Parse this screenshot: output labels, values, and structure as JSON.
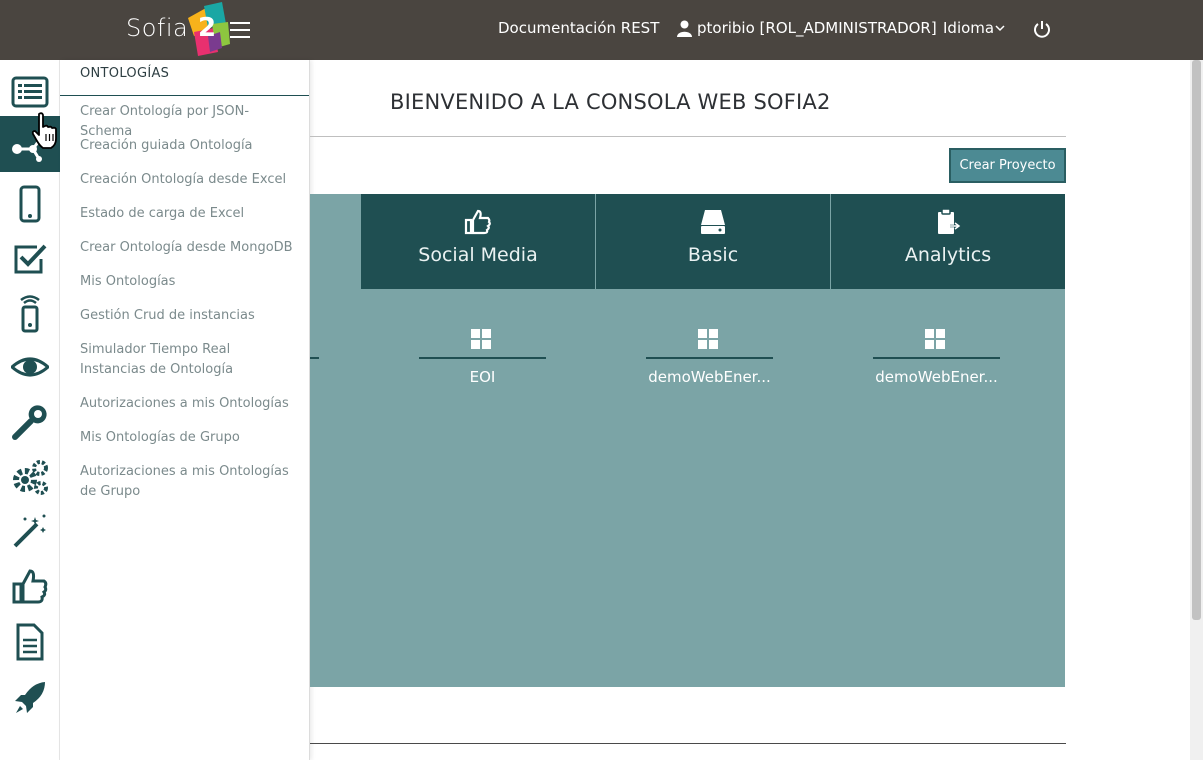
{
  "header": {
    "logo_text": "Sofia",
    "logo_number": "2",
    "doc_link": "Documentación REST",
    "user": "ptoribio [ROL_ADMINISTRADOR]",
    "language": "Idioma"
  },
  "rail": {
    "icons": [
      "list-icon",
      "ontology-network-icon",
      "mobile-icon",
      "checkbox-icon",
      "remote-device-icon",
      "eye-icon",
      "wrench-icon",
      "gears-icon",
      "magic-wand-icon",
      "thumbs-up-icon",
      "document-icon",
      "rocket-icon"
    ],
    "active_index": 1
  },
  "flyout": {
    "title": "ONTOLOGÍAS",
    "items": [
      "Crear Ontología por JSON-Schema",
      "Creación guiada Ontología",
      "Creación Ontología desde Excel",
      "Estado de carga de Excel",
      "Crear Ontología desde MongoDB",
      "Mis Ontologías",
      "Gestión Crud de instancias",
      "Simulador Tiempo Real Instancias de Ontología",
      "Autorizaciones a mis Ontologías",
      "Mis Ontologías de Grupo",
      "Autorizaciones a mis Ontologías de Grupo"
    ]
  },
  "main": {
    "title": "BIENVENIDO A LA CONSOLA WEB SOFIA2",
    "create_button": "Crear Proyecto",
    "tabs": [
      {
        "label": "Social Media",
        "icon": "thumbs-up-icon"
      },
      {
        "label": "Basic",
        "icon": "server-icon"
      },
      {
        "label": "Analytics",
        "icon": "clipboard-export-icon"
      }
    ],
    "projects": [
      {
        "label": "EOI"
      },
      {
        "label": "demoWebEner..."
      },
      {
        "label": "demoWebEner..."
      }
    ]
  },
  "colors": {
    "header_bg": "#4a4540",
    "accent_dark": "#1f4f52",
    "panel_bg": "#7ba4a6",
    "button_bg": "#4c8a93"
  }
}
